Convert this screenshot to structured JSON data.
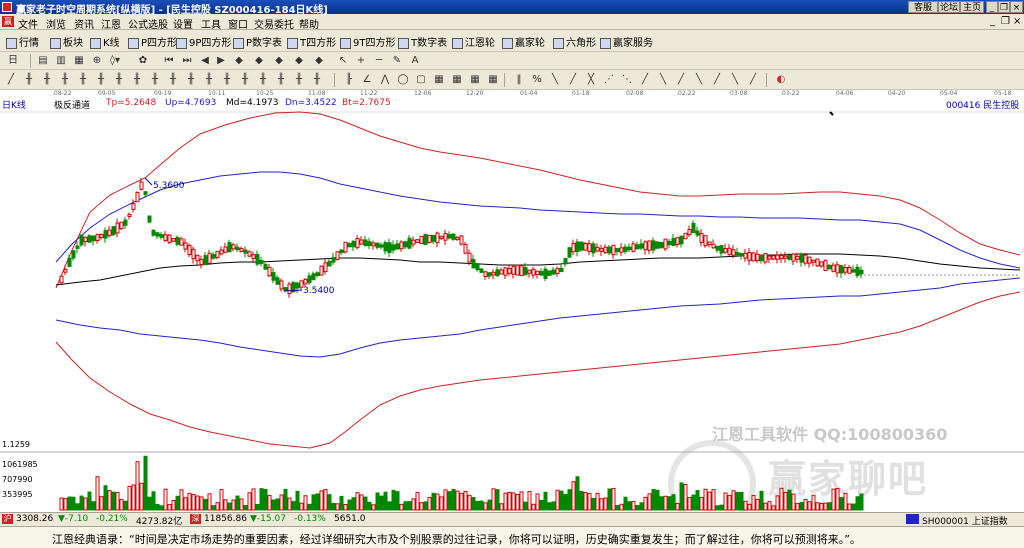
{
  "window": {
    "title": "赢家老子时空周期系统[纵横版] - [民生控股  SZ000416-184日K线]",
    "buttons": [
      "客服",
      "论坛",
      "主页"
    ]
  },
  "menubar": [
    "文件",
    "浏览",
    "资讯",
    "江恩",
    "公式选股",
    "设置",
    "工具",
    "窗口",
    "交易委托",
    "帮助"
  ],
  "toolbar1": [
    "行情",
    "板块",
    "K线",
    "P四方形",
    "9P四方形",
    "P数字表",
    "T四方形",
    "9T四方形",
    "T数字表",
    "江恩轮",
    "赢家轮",
    "六角形",
    "赢家服务"
  ],
  "date_axis": [
    "08-22",
    "09-05",
    "09-19",
    "10-11",
    "10-25",
    "11-08",
    "11-22",
    "12-06",
    "12-20",
    "01-04",
    "01-18",
    "02-08",
    "02-22",
    "03-08",
    "03-22",
    "04-06",
    "04-20",
    "05-04",
    "05-18"
  ],
  "chart_header": {
    "period": "日K线",
    "indicator": "极反通道",
    "tp": "Tp=5.2648",
    "up": "Up=4.7693",
    "md": "Md=4.1973",
    "dn": "Dn=3.4522",
    "bt": "Bt=2.7675",
    "stock": "000416  民生控股"
  },
  "annotations": {
    "high": "5.3600",
    "low": "3.5400"
  },
  "volume_axis": [
    "1.1259",
    "1061985",
    "707990",
    "353995"
  ],
  "watermark": {
    "line1": "江恩工具软件  QQ:100800360",
    "line2": "赢家聊吧"
  },
  "statusbar": {
    "sh_index": "3308.26",
    "sh_change": "▼-7.10",
    "sh_pct": "-0.21%",
    "sh_amount": "4273.82亿",
    "sz_index": "11856.86",
    "sz_change": "▼-15.07",
    "sz_pct": "-0.13%",
    "sz_amount": "5651.0",
    "right": "SH000001 上证指数"
  },
  "quote": "江恩经典语录：“时间是决定市场走势的重要因素，经过详细研究大市及个别股票的过往记录，你将可以证明，历史确实重复发生；而了解过往，你将可以预测将来。”。",
  "colors": {
    "outer_channel": "#cc2222",
    "inner_channel": "#2222cc",
    "mid_line": "#000000",
    "up_candle": "#d40000",
    "down_candle": "#008800"
  }
}
